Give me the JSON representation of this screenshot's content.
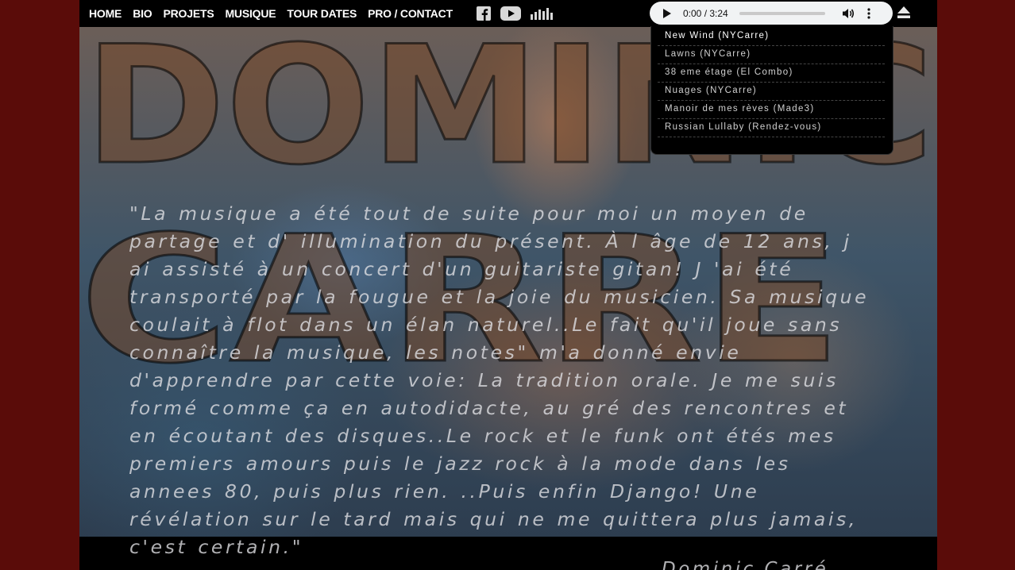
{
  "colors": {
    "page_background": "#5a0c09",
    "nav_background": "#000000",
    "nav_text": "#ffffff",
    "quote_text": "#e1e1e6",
    "player_background": "#f1f3f4"
  },
  "nav": {
    "items": [
      {
        "label": "HOME"
      },
      {
        "label": "BIO"
      },
      {
        "label": "PROJETS"
      },
      {
        "label": "MUSIQUE"
      },
      {
        "label": "TOUR DATES"
      },
      {
        "label": "PRO / CONTACT"
      }
    ],
    "social": [
      "facebook-icon",
      "youtube-icon",
      "soundcloud-icon"
    ]
  },
  "player": {
    "time": "0:00 / 3:24",
    "progress": 0
  },
  "playlist": [
    {
      "title": "New Wind (NYCarre)"
    },
    {
      "title": "Lawns (NYCarre)"
    },
    {
      "title": "38 eme étage (El Combo)"
    },
    {
      "title": "Nuages (NYCarre)"
    },
    {
      "title": "Manoir de mes rèves (Made3)"
    },
    {
      "title": "Russian Lullaby (Rendez-vous)"
    }
  ],
  "background": {
    "line1": "DOMINIC",
    "line2": "CARRE"
  },
  "quote": {
    "lines": [
      "\"La musique a été tout de suite pour moi un moyen de",
      "partage et d' illumination du présent. À l âge de 12 ans, j",
      "ai assisté à un concert d'un guitariste gitan! J 'ai été",
      "transporté par la fougue et la joie du musicien. Sa musique",
      "coulait à flot dans un élan naturel..Le fait qu'il joue sans",
      "connaître la musique, les notes\" m'a donné envie",
      "d'apprendre par cette voie: La tradition orale. Je me suis",
      "formé comme ça en autodidacte, au gré des rencontres et",
      "en écoutant des disques..Le rock et le funk ont étés mes",
      "premiers amours puis le jazz rock à la mode dans les",
      "annees 80, puis plus rien. ..Puis enfin Django! Une",
      "révélation sur le tard mais qui ne me quittera plus jamais,",
      "c'est certain.\""
    ],
    "signature": "Dominic Carré"
  }
}
